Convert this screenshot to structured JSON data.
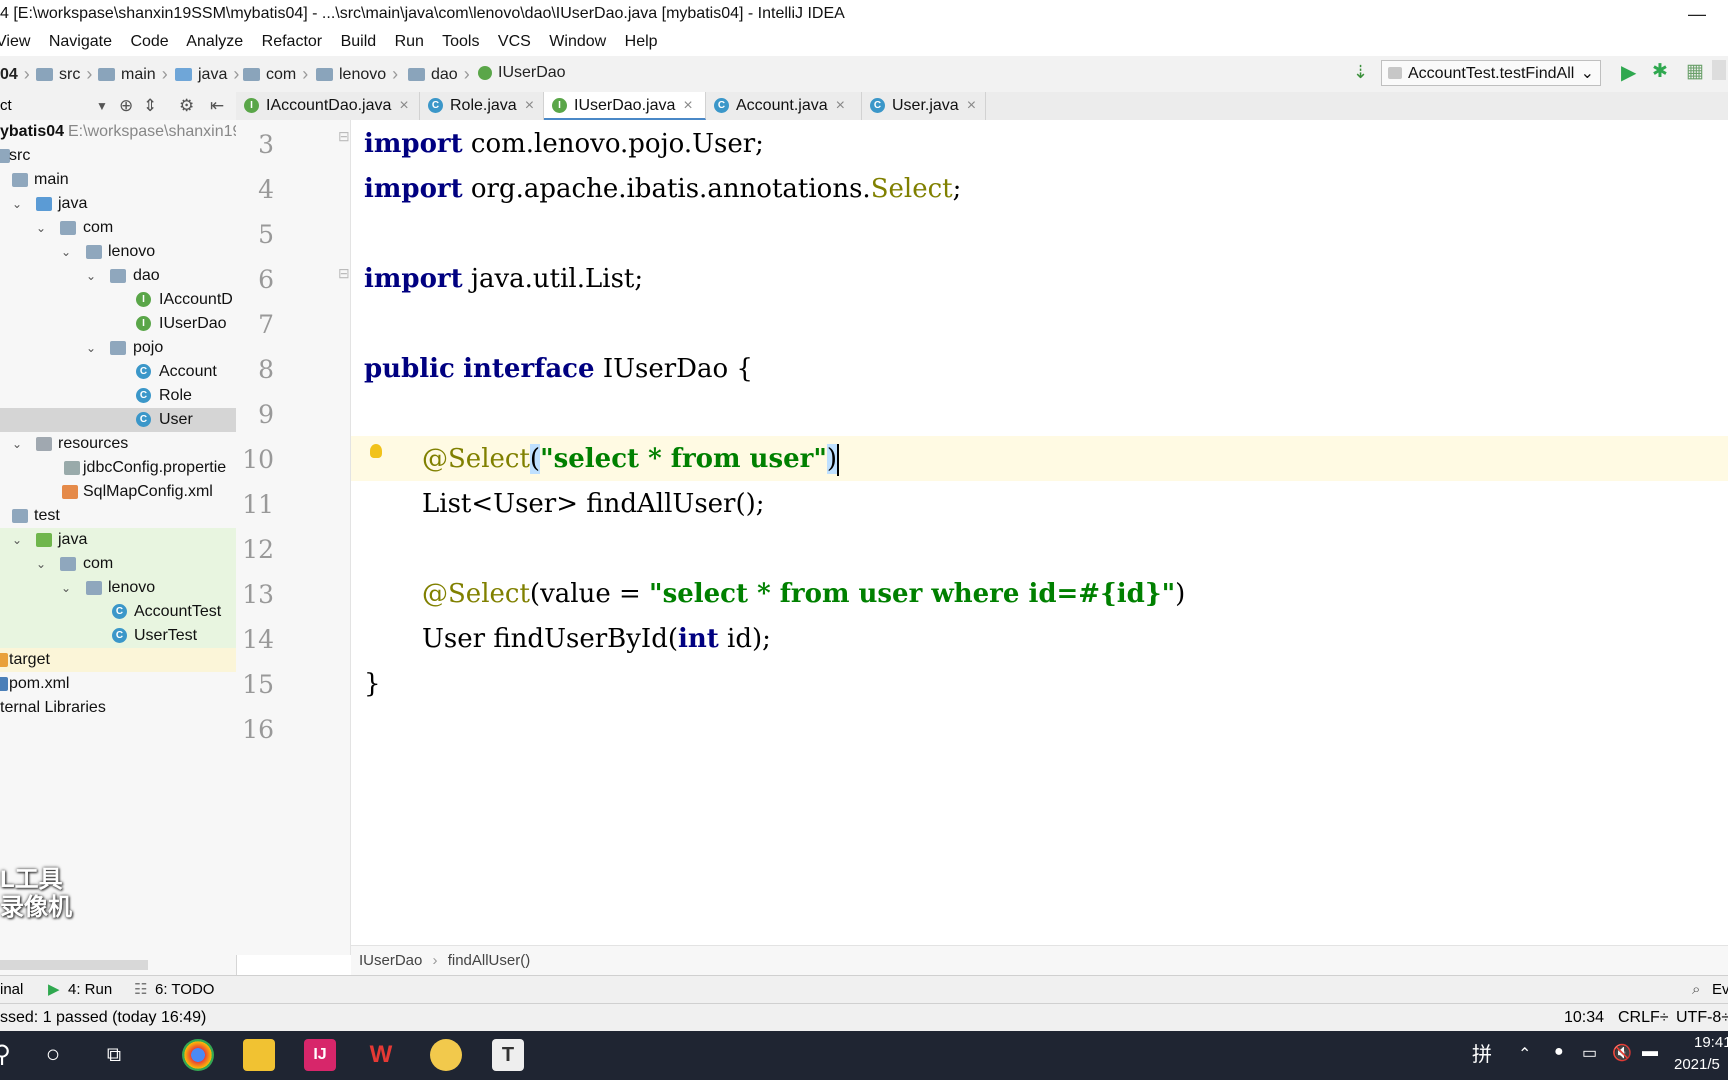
{
  "window": {
    "title": "4 [E:\\workspase\\shanxin19SSM\\mybatis04] - ...\\src\\main\\java\\com\\lenovo\\dao\\IUserDao.java [mybatis04] - IntelliJ IDEA",
    "minimize": "—"
  },
  "menu": [
    "View",
    "Navigate",
    "Code",
    "Analyze",
    "Refactor",
    "Build",
    "Run",
    "Tools",
    "VCS",
    "Window",
    "Help"
  ],
  "nav": {
    "crumbs": [
      "04",
      "src",
      "main",
      "java",
      "com",
      "lenovo",
      "dao",
      "IUserDao"
    ],
    "run_config": "AccountTest.testFindAll"
  },
  "project": {
    "header": "ct",
    "rows": [
      {
        "label": "ybatis04",
        "extra": "E:\\workspase\\shanxin19"
      },
      {
        "label": "src"
      },
      {
        "label": "main"
      },
      {
        "label": "java"
      },
      {
        "label": "com"
      },
      {
        "label": "lenovo"
      },
      {
        "label": "dao"
      },
      {
        "label": "IAccountD"
      },
      {
        "label": "IUserDao"
      },
      {
        "label": "pojo"
      },
      {
        "label": "Account"
      },
      {
        "label": "Role"
      },
      {
        "label": "User"
      },
      {
        "label": "resources"
      },
      {
        "label": "jdbcConfig.propertie"
      },
      {
        "label": "SqlMapConfig.xml"
      },
      {
        "label": "test"
      },
      {
        "label": "java"
      },
      {
        "label": "com"
      },
      {
        "label": "lenovo"
      },
      {
        "label": "AccountTest"
      },
      {
        "label": "UserTest"
      },
      {
        "label": "target"
      },
      {
        "label": "pom.xml"
      },
      {
        "label": "ternal Libraries"
      }
    ]
  },
  "tabs": [
    {
      "label": "IAccountDao.java",
      "icon": "I"
    },
    {
      "label": "Role.java",
      "icon": "C"
    },
    {
      "label": "IUserDao.java",
      "icon": "I"
    },
    {
      "label": "Account.java",
      "icon": "C"
    },
    {
      "label": "User.java",
      "icon": "C"
    }
  ],
  "editor": {
    "line_numbers": [
      "3",
      "4",
      "5",
      "6",
      "7",
      "8",
      "9",
      "10",
      "11",
      "12",
      "13",
      "14",
      "15",
      "16"
    ],
    "lines": {
      "l3_kw": "import",
      "l3_rest": " com.lenovo.pojo.User;",
      "l4_kw": "import",
      "l4_rest": " org.apache.ibatis.annotations.",
      "l4_ann": "Select",
      "l4_end": ";",
      "l6_kw": "import",
      "l6_rest": " java.util.List;",
      "l8_kw1": "public",
      "l8_kw2": "interface",
      "l8_rest": " IUserDao {",
      "l10_ann": "@Select",
      "l10_open": "(",
      "l10_str": "\"select * from user\"",
      "l10_close": ")",
      "l11": "List<User> findAllUser();",
      "l13_ann": "@Select",
      "l13_mid": "(value = ",
      "l13_str": "\"select * from user where id=#{id}\"",
      "l13_end": ")",
      "l14_pre": "User findUserById(",
      "l14_kw": "int",
      "l14_post": " id);",
      "l15": "}"
    },
    "breadcrumb": [
      "IUserDao",
      "findAllUser()"
    ]
  },
  "toolwindows": {
    "terminal": "inal",
    "run": "4: Run",
    "todo": "6: TODO",
    "event": "Ev"
  },
  "status": {
    "message": "ssed: 1 passed (today 16:49)",
    "position": "10:34",
    "line_sep": "CRLF÷",
    "encoding": "UTF-8÷"
  },
  "taskbar": {
    "ime": "拼",
    "time": "19:41",
    "date": "2021/5"
  },
  "watermark": {
    "line1": "L工具",
    "line2": "录像机"
  }
}
